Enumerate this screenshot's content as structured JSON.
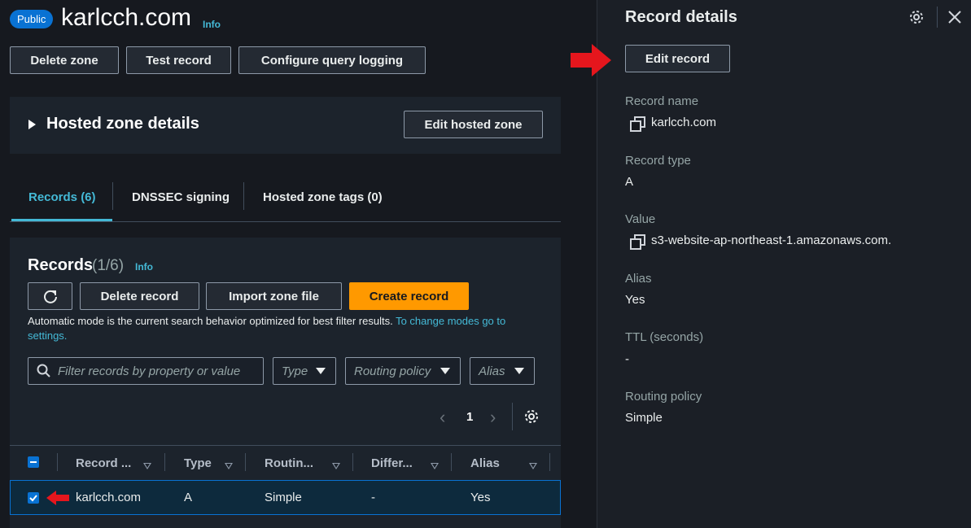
{
  "header": {
    "badge": "Public",
    "title": "karlcch.com",
    "info": "Info",
    "buttons": [
      "Delete zone",
      "Test record",
      "Configure query logging"
    ]
  },
  "hosted_zone": {
    "title": "Hosted zone details",
    "edit_button": "Edit hosted zone"
  },
  "tabs": [
    {
      "label": "Records (6)",
      "active": true
    },
    {
      "label": "DNSSEC signing",
      "active": false
    },
    {
      "label": "Hosted zone tags (0)",
      "active": false
    }
  ],
  "records_panel": {
    "title": "Records",
    "count": "(1/6)",
    "info": "Info",
    "refresh_icon": "refresh-icon",
    "delete_button": "Delete record",
    "import_button": "Import zone file",
    "create_button": "Create record",
    "mode_text": "Automatic mode is the current search behavior optimized for best filter results.",
    "mode_link_1": "To change modes go to",
    "mode_link_2": "settings.",
    "search_placeholder": "Filter records by property or value",
    "filters": [
      "Type",
      "Routing policy",
      "Alias"
    ],
    "page": "1",
    "columns": [
      "Record ...",
      "Type",
      "Routin...",
      "Differ...",
      "Alias"
    ],
    "rows": [
      {
        "name": "karlcch.com",
        "type": "A",
        "routing": "Simple",
        "differ": "-",
        "alias": "Yes",
        "selected": true
      }
    ]
  },
  "details": {
    "title": "Record details",
    "edit_button": "Edit record",
    "fields": [
      {
        "label": "Record name",
        "value": "karlcch.com",
        "copy": true
      },
      {
        "label": "Record type",
        "value": "A",
        "copy": false
      },
      {
        "label": "Value",
        "value": "s3-website-ap-northeast-1.amazonaws.com.",
        "copy": true
      },
      {
        "label": "Alias",
        "value": "Yes",
        "copy": false
      },
      {
        "label": "TTL (seconds)",
        "value": "-",
        "copy": false
      },
      {
        "label": "Routing policy",
        "value": "Simple",
        "copy": false
      }
    ]
  },
  "colors": {
    "accent": "#44b9d6",
    "primary": "#ff9900",
    "annotation": "#e5161d"
  }
}
